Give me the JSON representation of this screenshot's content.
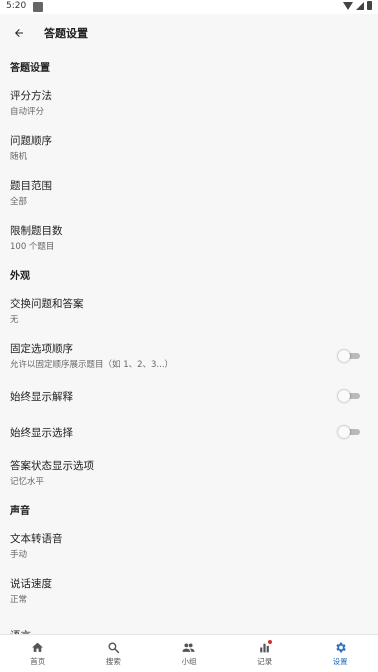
{
  "status_bar": {
    "time": "5:20"
  },
  "app_bar": {
    "title": "答题设置"
  },
  "sections": {
    "answer": {
      "header": "答题设置",
      "scoring": {
        "title": "评分方法",
        "value": "自动评分"
      },
      "order": {
        "title": "问题顺序",
        "value": "随机"
      },
      "range": {
        "title": "题目范围",
        "value": "全部"
      },
      "limit": {
        "title": "限制题目数",
        "value": "100 个题目"
      }
    },
    "appearance": {
      "header": "外观",
      "swap": {
        "title": "交换问题和答案",
        "value": "无"
      },
      "fixed_order": {
        "title": "固定选项顺序",
        "value": "允许以固定顺序展示题目（如 1、2、3...）",
        "enabled": false
      },
      "show_explanation": {
        "title": "始终显示解释",
        "enabled": false
      },
      "show_choices": {
        "title": "始终显示选择",
        "enabled": false
      },
      "status_options": {
        "title": "答案状态显示选项",
        "value": "记忆水平"
      }
    },
    "sound": {
      "header": "声音",
      "tts": {
        "title": "文本转语音",
        "value": "手动"
      },
      "speed": {
        "title": "说话速度",
        "value": "正常"
      },
      "language": {
        "title": "语言"
      }
    }
  },
  "bottom_nav": {
    "home": "首页",
    "search": "搜索",
    "group": "小组",
    "records": "记录",
    "settings": "设置",
    "active_color": "#2c6fbb",
    "badge_color": "#d32f2f"
  }
}
